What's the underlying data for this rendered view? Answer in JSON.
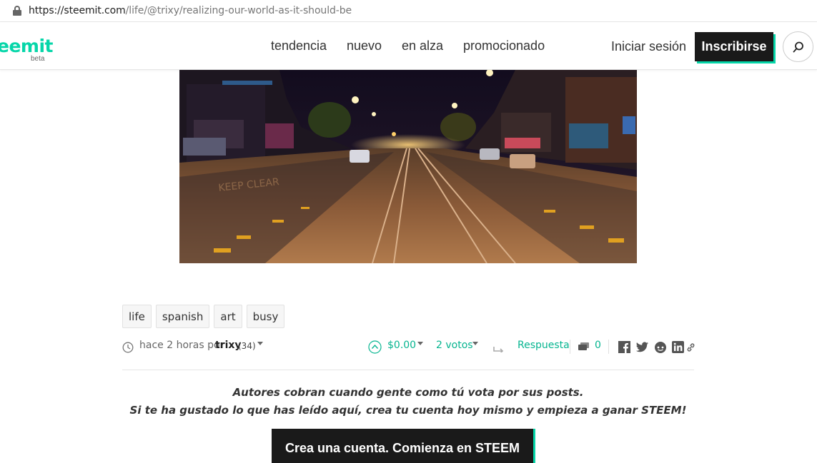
{
  "browser": {
    "url_host": "https://steemit.com",
    "url_path": "/life/@trixy/realizing-our-world-as-it-should-be"
  },
  "header": {
    "logo_text": "eemit",
    "logo_badge": "beta",
    "nav": [
      "tendencia",
      "nuevo",
      "en alza",
      "promocionado"
    ],
    "login": "Iniciar sesión",
    "signup": "Inscribirse",
    "search_icon": "search-icon"
  },
  "post": {
    "image": "night-street-tram-tracks",
    "tags": [
      "life",
      "spanish",
      "art",
      "busy"
    ],
    "meta": {
      "time": "hace 2 horas por",
      "author": "trixy",
      "reputation": "(34)",
      "payout": "$0.00",
      "votes": "2 votos",
      "reply": "Respuesta",
      "comments": "0"
    }
  },
  "cta": {
    "line1": "Autores cobran cuando gente como tú vota por sus posts.",
    "line2": "Si te ha gustado lo que has leído aquí, crea tu cuenta hoy mismo y empieza a ganar STEEM!",
    "button": "Crea una cuenta. Comienza en STEEM"
  },
  "colors": {
    "accent": "#06d6a9",
    "dark": "#1a1a1a"
  }
}
